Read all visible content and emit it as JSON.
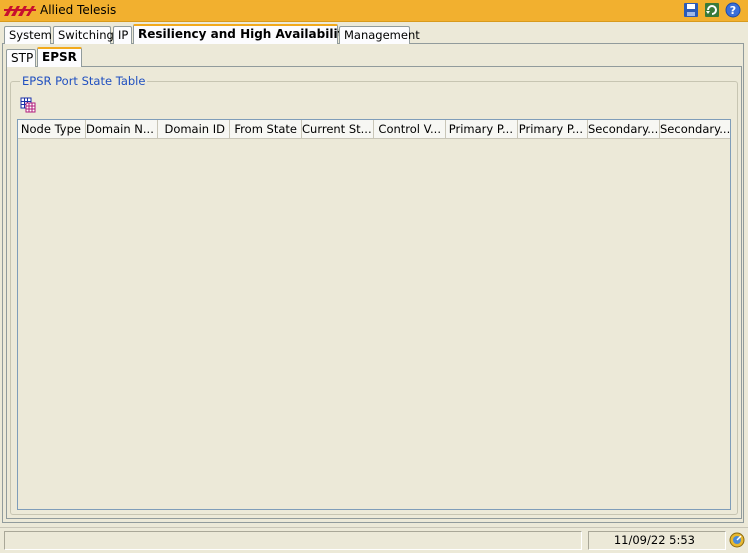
{
  "window": {
    "title": "Allied Telesis",
    "brand_color": "#f2b02f",
    "icons": [
      "save-icon",
      "refresh-icon",
      "help-icon"
    ]
  },
  "tabs": [
    {
      "label": "System",
      "active": false
    },
    {
      "label": "Switching",
      "active": false
    },
    {
      "label": "IP",
      "active": false
    },
    {
      "label": "Resiliency and High Availability",
      "active": true
    },
    {
      "label": "Management",
      "active": false
    }
  ],
  "subtabs": [
    {
      "label": "STP",
      "active": false
    },
    {
      "label": "EPSR",
      "active": true
    }
  ],
  "group": {
    "title": "EPSR Port State Table",
    "toolbar_icon": "table-columns-icon"
  },
  "table": {
    "columns": [
      "Node Type",
      "Domain N...",
      "Domain ID",
      "From State",
      "Current St...",
      "Control V...",
      "Primary P...",
      "Primary P...",
      "Secondary...",
      "Secondary..."
    ],
    "rows": []
  },
  "status": {
    "text": "",
    "datetime": "11/09/22 5:53",
    "icon": "status-icon"
  }
}
